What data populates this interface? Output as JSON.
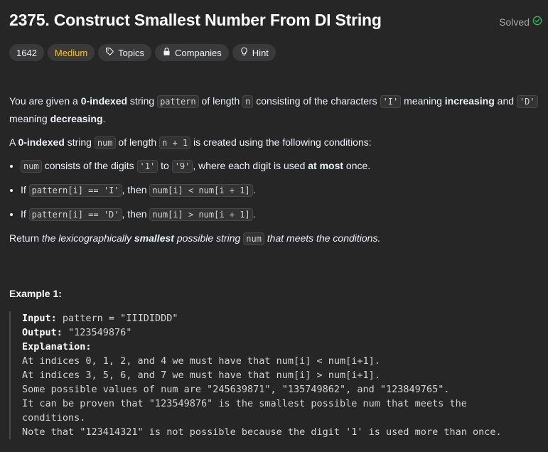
{
  "header": {
    "title": "2375. Construct Smallest Number From DI String",
    "status": "Solved"
  },
  "tags": {
    "id": "1642",
    "difficulty": "Medium",
    "topics": "Topics",
    "companies": "Companies",
    "hint": "Hint"
  },
  "colors": {
    "medium": "#ffc01e",
    "solved": "#2cbb5d",
    "background": "#262626"
  },
  "desc": {
    "p1": {
      "t1": "You are given a ",
      "b1": "0-indexed",
      "t2": " string ",
      "c1": "pattern",
      "t3": " of length ",
      "c2": "n",
      "t4": " consisting of the characters ",
      "c3": "'I'",
      "t5": " meaning ",
      "b2": "increasing",
      "t6": " and ",
      "c4": "'D'",
      "t7": " meaning ",
      "b3": "decreasing",
      "t8": "."
    },
    "p2": {
      "t1": "A ",
      "b1": "0-indexed",
      "t2": " string ",
      "c1": "num",
      "t3": " of length ",
      "c2": "n + 1",
      "t4": " is created using the following conditions:"
    },
    "bullets": {
      "b1": {
        "c1": "num",
        "t1": " consists of the digits ",
        "c2": "'1'",
        "t2": " to ",
        "c3": "'9'",
        "t3": ", where each digit is used ",
        "b1": "at most",
        "t4": " once."
      },
      "b2": {
        "t1": "If ",
        "c1": "pattern[i] == 'I'",
        "t2": ", then ",
        "c2": "num[i] < num[i + 1]",
        "t3": "."
      },
      "b3": {
        "t1": "If ",
        "c1": "pattern[i] == 'D'",
        "t2": ", then ",
        "c2": "num[i] > num[i + 1]",
        "t3": "."
      }
    },
    "p3": {
      "t1": "Return ",
      "i1": "the lexicographically ",
      "ib": "smallest",
      "i2": " possible string ",
      "c1": "num",
      "i3": " that meets the conditions."
    }
  },
  "example": {
    "title": "Example 1:",
    "input_label": "Input:",
    "input_value": " pattern = \"IIIDIDDD\"",
    "output_label": "Output:",
    "output_value": " \"123549876\"",
    "explanation_label": "Explanation:",
    "lines": [
      "At indices 0, 1, 2, and 4 we must have that num[i] < num[i+1].",
      "At indices 3, 5, 6, and 7 we must have that num[i] > num[i+1].",
      "Some possible values of num are \"245639871\", \"135749862\", and \"123849765\".",
      "It can be proven that \"123549876\" is the smallest possible num that meets the",
      "conditions.",
      "Note that \"123414321\" is not possible because the digit '1' is used more than once."
    ]
  }
}
